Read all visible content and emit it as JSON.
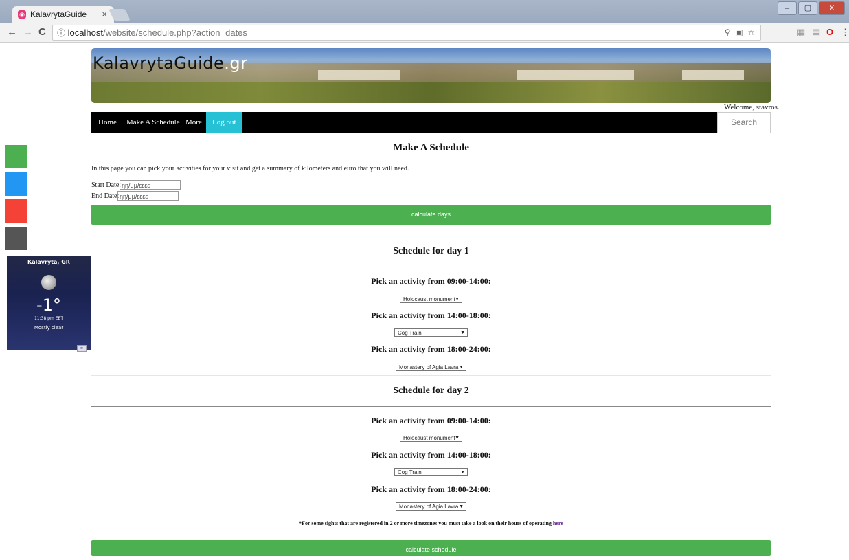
{
  "browser": {
    "tab_title": "KalavrytaGuide",
    "tab_close": "×",
    "back": "←",
    "forward": "→",
    "reload": "C",
    "url_host": "localhost",
    "url_path": "/website/schedule.php?action=dates",
    "win_min": "–",
    "win_max": "▢",
    "win_close": "X"
  },
  "site": {
    "title_main": "KalavrytaGuide",
    "title_suffix": ".gr",
    "welcome": "Welcome, stavros."
  },
  "nav": {
    "home": "Home",
    "make_schedule": "Make A Schedule",
    "more": "More",
    "logout": "Log out",
    "search_placeholder": "Search"
  },
  "page": {
    "heading": "Make A Schedule",
    "intro": "In this page you can pick your activities for your visit and get a summary of kilometers and euro that you will need.",
    "start_label": "Start Date:",
    "start_value": "ηη/μμ/εεεε",
    "end_label": "End Date:",
    "end_value": "ηη/μμ/εεεε",
    "calc_days": "calculate days",
    "calc_schedule": "calculate schedule",
    "note_text": "*For some sights that are registered in 2 or more timezones you must take a look on their hours of operating ",
    "note_link": "here"
  },
  "days": [
    {
      "title": "Schedule for day 1",
      "slots": [
        {
          "label": "Pick an activity from 09:00-14:00:",
          "value": "Holocaust monument"
        },
        {
          "label": "Pick an activity from 14:00-18:00:",
          "value": "Cog Train"
        },
        {
          "label": "Pick an activity from 18:00-24:00:",
          "value": "Monastery of Agia Lavra"
        }
      ]
    },
    {
      "title": "Schedule for day 2",
      "slots": [
        {
          "label": "Pick an activity from 09:00-14:00:",
          "value": "Holocaust monument"
        },
        {
          "label": "Pick an activity from 14:00-18:00:",
          "value": "Cog Train"
        },
        {
          "label": "Pick an activity from 18:00-24:00:",
          "value": "Monastery of Agia Lavra"
        }
      ]
    }
  ],
  "weather": {
    "city": "Kalavryta, GR",
    "temp": "-1°",
    "time": "11:38 pm EET",
    "condition": "Mostly clear"
  },
  "colors": {
    "accent_green": "#4caf50",
    "logout_cyan": "#27c1d6",
    "navbar": "#000000",
    "social": [
      "#4caf50",
      "#2196f3",
      "#f44336",
      "#555555"
    ]
  }
}
